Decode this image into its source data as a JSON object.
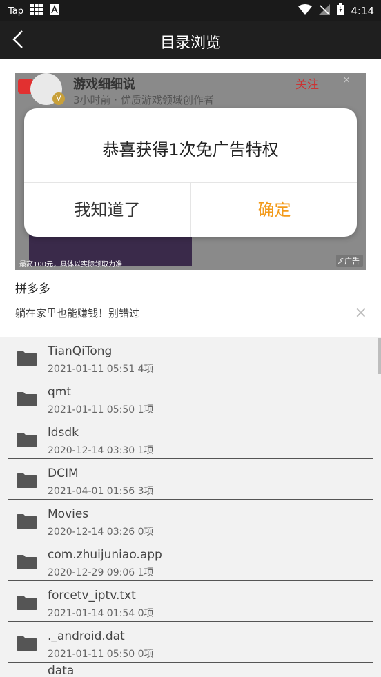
{
  "status_bar": {
    "left_label": "Tap",
    "time": "4:14"
  },
  "header": {
    "title": "目录浏览"
  },
  "ad": {
    "author": "游戏细细说",
    "meta": "3小时前 · 优质游戏领域创作者",
    "follow": "关注",
    "close_small": "×",
    "note": "最高100元，具体以实际领取为准",
    "tag": "广告",
    "brand": "拼多多",
    "slogan": "躺在家里也能赚钱！别错过",
    "close": "×"
  },
  "dialog": {
    "message": "恭喜获得1次免广告特权",
    "cancel": "我知道了",
    "confirm": "确定"
  },
  "files": [
    {
      "name": "TianQiTong",
      "date": "2021-01-11 05:51",
      "count": "4项"
    },
    {
      "name": "qmt",
      "date": "2021-01-11 05:50",
      "count": "1项"
    },
    {
      "name": "ldsdk",
      "date": "2020-12-14 03:30",
      "count": "1项"
    },
    {
      "name": "DCIM",
      "date": "2021-04-01 01:56",
      "count": "3项"
    },
    {
      "name": "Movies",
      "date": "2020-12-14 03:26",
      "count": "0项"
    },
    {
      "name": "com.zhuijuniao.app",
      "date": "2020-12-29 09:06",
      "count": "1项"
    },
    {
      "name": "forcetv_iptv.txt",
      "date": "2021-01-14 01:54",
      "count": "0项"
    },
    {
      "name": "._android.dat",
      "date": "2021-01-11 05:50",
      "count": "0项"
    },
    {
      "name": "data",
      "date": "",
      "count": ""
    }
  ]
}
